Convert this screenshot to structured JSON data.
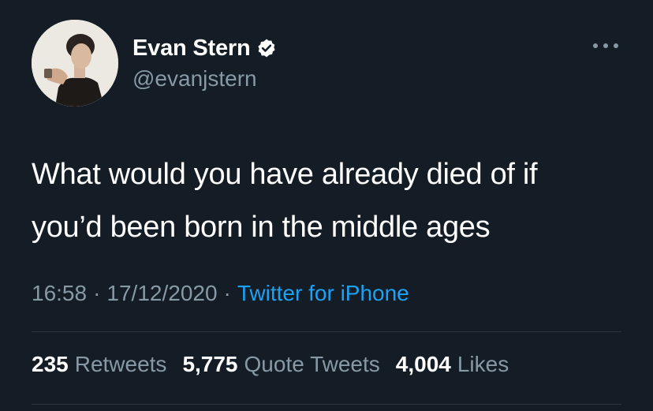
{
  "author": {
    "display_name": "Evan Stern",
    "handle": "@evanjstern",
    "verified": true,
    "avatar_icon": "profile-photo"
  },
  "tweet": {
    "lines": [
      "What would you have already died of if",
      "you’d been born in the middle ages"
    ]
  },
  "meta": {
    "time": "16:58",
    "date": "17/12/2020",
    "source": "Twitter for iPhone",
    "separator": "·"
  },
  "stats": {
    "retweets_count": "235",
    "retweets_label": "Retweets",
    "quotes_count": "5,775",
    "quotes_label": "Quote Tweets",
    "likes_count": "4,004",
    "likes_label": "Likes"
  },
  "colors": {
    "background": "#141d26",
    "primary_text": "#ffffff",
    "secondary_text": "#8899a6",
    "link": "#1da1f2"
  }
}
